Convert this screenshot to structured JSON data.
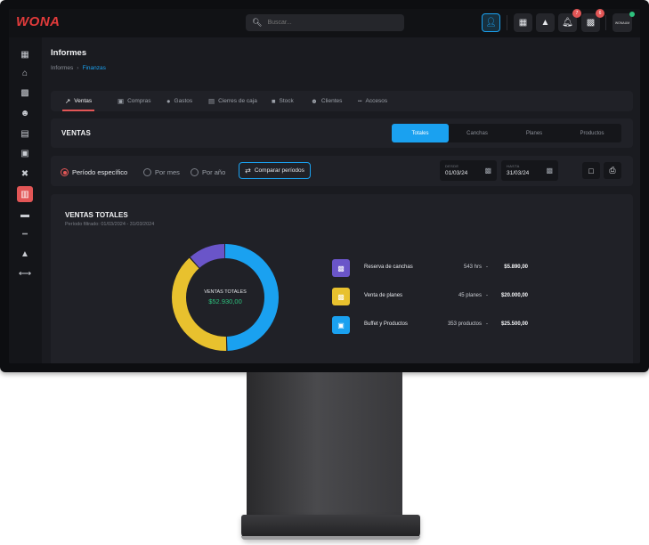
{
  "app": {
    "logo": "WONA"
  },
  "topbar": {
    "search_placeholder": "Buscar...",
    "notifications_count": "7",
    "messages_count": "6",
    "avatar_text": "WONAUM"
  },
  "page": {
    "title": "Informes",
    "breadcrumb": [
      "Informes",
      "Finanzas"
    ]
  },
  "tabs": [
    {
      "label": "Ventas",
      "icon": "chart-line-icon",
      "active": true
    },
    {
      "label": "Compras",
      "icon": "cart-icon"
    },
    {
      "label": "Gastos",
      "icon": "dollar-icon"
    },
    {
      "label": "Cierres de caja",
      "icon": "cash-register-icon"
    },
    {
      "label": "Stock",
      "icon": "box-icon"
    },
    {
      "label": "Clientes",
      "icon": "users-icon"
    },
    {
      "label": "Accesos",
      "icon": "barrier-icon"
    }
  ],
  "ventas_panel": {
    "title": "VENTAS",
    "segments": [
      "Totales",
      "Canchas",
      "Planes",
      "Productos"
    ],
    "active_segment": "Totales"
  },
  "filters": {
    "options": [
      "Período específico",
      "Por mes",
      "Por año"
    ],
    "selected": "Período específico",
    "compare_label": "Comparar períodos",
    "from_label": "DESDE",
    "from_value": "01/03/24",
    "to_label": "HASTA",
    "to_value": "31/03/24"
  },
  "totals": {
    "title": "VENTAS TOTALES",
    "subtitle": "Período filtrado: 01/03/2024 - 31/03/2024",
    "center_label": "VENTAS TOTALES",
    "center_value": "$52.930,00",
    "items": [
      {
        "name": "Reserva de canchas",
        "qty": "543 hrs",
        "amount": "$5.890,00",
        "color": "#6a55c9",
        "icon": "calendar-icon"
      },
      {
        "name": "Venta de planes",
        "qty": "45 planes",
        "amount": "$20.000,00",
        "color": "#e8c12e",
        "icon": "ticket-icon"
      },
      {
        "name": "Buffet y Productos",
        "qty": "353 productos",
        "amount": "$25.500,00",
        "color": "#1aa1f0",
        "icon": "store-icon"
      }
    ]
  },
  "chart_data": {
    "type": "pie",
    "categories": [
      "Reserva de canchas",
      "Venta de planes",
      "Buffet y Productos"
    ],
    "values": [
      5890,
      20000,
      25500
    ],
    "colors": [
      "#6a55c9",
      "#e8c12e",
      "#1aa1f0"
    ],
    "title": "VENTAS TOTALES"
  },
  "colors": {
    "accent_red": "#e25656",
    "accent_blue": "#1aa1f0",
    "accent_green": "#2ec27e"
  }
}
